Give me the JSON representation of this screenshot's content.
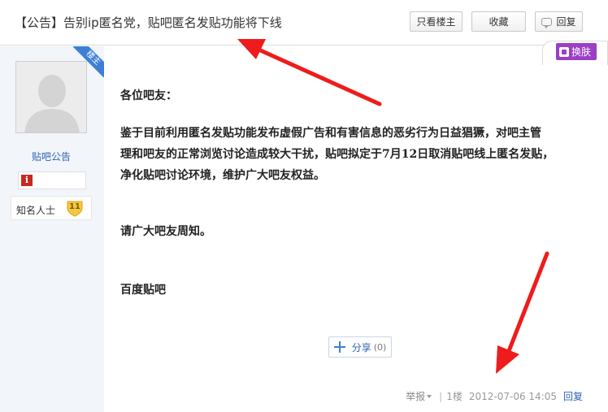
{
  "header": {
    "title": "【公告】告别ip匿名党，贴吧匿名发贴功能将下线",
    "only_author_label": "只看楼主",
    "favorite_label": "收藏",
    "reply_label": "回复"
  },
  "skin": {
    "label": "换肤",
    "icon": "skin-icon"
  },
  "author": {
    "badge": "楼主",
    "name": "贴吧公告",
    "info_icon": "info-icon",
    "level_name": "知名人士",
    "level": "11"
  },
  "post": {
    "greeting": "各位吧友：",
    "body": "鉴于目前利用匿名发贴功能发布虚假广告和有害信息的恶劣行为日益猖獗，对吧主管\n理和吧友的正常浏览讨论造成较大干扰，贴吧拟定于7月12日取消贴吧线上匿名发贴，\n净化贴吧讨论环境，维护广大吧友权益。",
    "notice": "请广大吧友周知。",
    "signature": "百度贴吧"
  },
  "share": {
    "label": "分享",
    "count": "(0)"
  },
  "footer": {
    "report_label": "举报",
    "separator": "|",
    "floor": "1楼",
    "timestamp": "2012-07-06 14:05",
    "reply_label": "回复"
  },
  "annotations": {
    "arrow_color": "#ee1c1c"
  }
}
